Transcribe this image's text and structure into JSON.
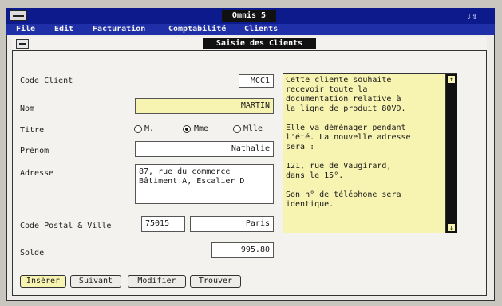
{
  "app": {
    "title": "Omnis 5",
    "scroll_arrows": "⇩⇧"
  },
  "menubar": [
    "File",
    "Edit",
    "Facturation",
    "Comptabilité",
    "Clients"
  ],
  "child_window": {
    "title": "Saisie des Clients"
  },
  "form": {
    "code_client": {
      "label": "Code Client",
      "value": "MCC1"
    },
    "nom": {
      "label": "Nom",
      "value": "MARTIN"
    },
    "titre": {
      "label": "Titre",
      "options": [
        "M.",
        "Mme",
        "Mlle"
      ],
      "selected": "Mme"
    },
    "prenom": {
      "label": "Prénom",
      "value": "Nathalie"
    },
    "adresse": {
      "label": "Adresse",
      "value": "87, rue du commerce\nBâtiment A, Escalier D"
    },
    "code_postal_ville": {
      "label": "Code Postal & Ville",
      "code_postal": "75015",
      "ville": "Paris"
    },
    "solde": {
      "label": "Solde",
      "value": "995.80"
    }
  },
  "notes": {
    "text": "Cette cliente souhaite\nrecevoir toute la\ndocumentation relative à\nla ligne de produit 80VD.\n\nElle va déménager pendant\nl'été. La nouvelle adresse\nsera :\n\n121, rue de Vaugirard,\ndans le 15°.\n\nSon n° de téléphone sera\nidentique.",
    "scroll_up": "↑",
    "scroll_down": "↓"
  },
  "buttons": {
    "inserer": "Insérer",
    "suivant": "Suivant",
    "modifier": "Modifier",
    "trouver": "Trouver"
  }
}
